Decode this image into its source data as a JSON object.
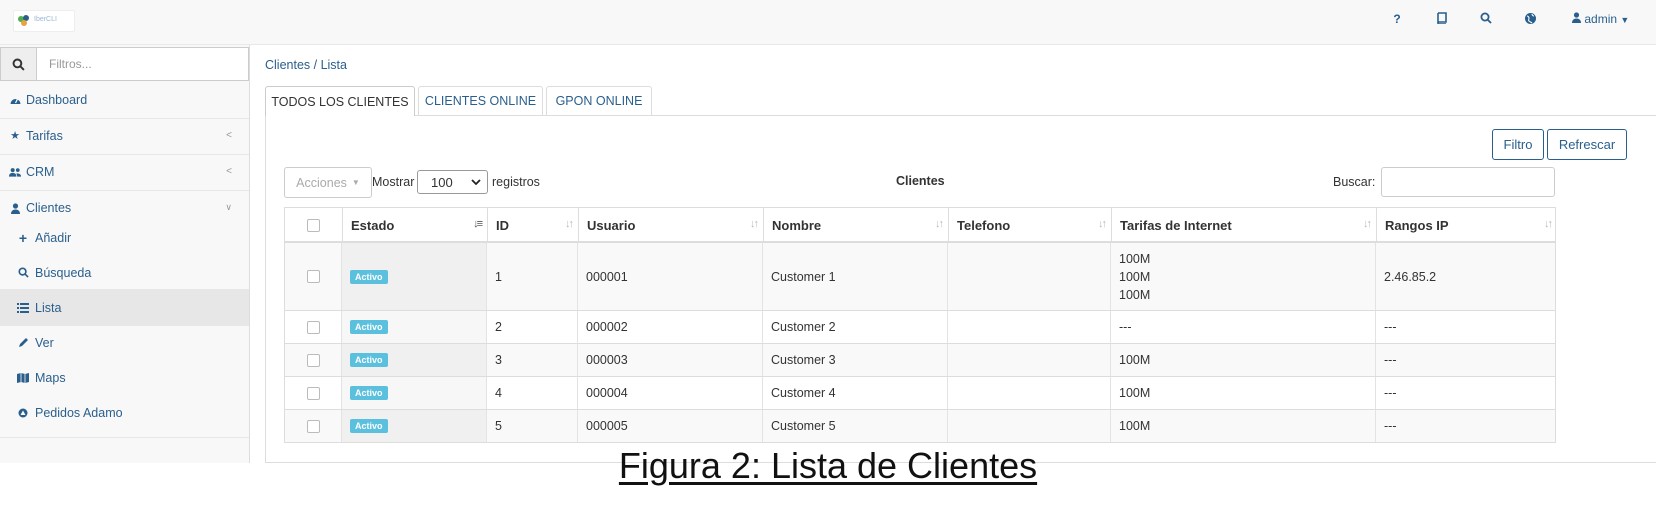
{
  "topbar": {
    "logo_text": "IberCLI",
    "help_label": "?",
    "user_label": "admin"
  },
  "sidebar": {
    "search_placeholder": "Filtros...",
    "items": [
      {
        "label": "Dashboard",
        "icon": "dashboard-icon"
      },
      {
        "label": "Tarifas",
        "icon": "star-icon"
      },
      {
        "label": "CRM",
        "icon": "users-icon"
      },
      {
        "label": "Clientes",
        "icon": "user-icon"
      }
    ],
    "subitems": [
      {
        "label": "Añadir",
        "icon": "plus-icon"
      },
      {
        "label": "Búsqueda",
        "icon": "search-icon"
      },
      {
        "label": "Lista",
        "icon": "list-icon"
      },
      {
        "label": "Ver",
        "icon": "pencil-icon"
      },
      {
        "label": "Maps",
        "icon": "map-icon"
      },
      {
        "label": "Pedidos Adamo",
        "icon": "circle-icon"
      }
    ]
  },
  "main": {
    "breadcrumb": "Clientes / Lista",
    "tabs": [
      "TODOS LOS CLIENTES",
      "CLIENTES ONLINE",
      "GPON ONLINE"
    ],
    "filter_button": "Filtro",
    "refresh_button": "Refrescar",
    "actions_label": "Acciones",
    "show_label": "Mostrar",
    "page_size": "100",
    "records_label": "registros",
    "table_title": "Clientes",
    "search_label": "Buscar:"
  },
  "table": {
    "columns": [
      "Estado",
      "ID",
      "Usuario",
      "Nombre",
      "Telefono",
      "Tarifas de Internet",
      "Rangos IP"
    ],
    "rows": [
      {
        "estado": "Activo",
        "id": "1",
        "usuario": "000001",
        "nombre": "Customer 1",
        "telefono": "",
        "tarifas": [
          "100M",
          "100M",
          "100M"
        ],
        "rangos": "2.46.85.2"
      },
      {
        "estado": "Activo",
        "id": "2",
        "usuario": "000002",
        "nombre": "Customer 2",
        "telefono": "",
        "tarifas": [
          "---"
        ],
        "rangos": "---"
      },
      {
        "estado": "Activo",
        "id": "3",
        "usuario": "000003",
        "nombre": "Customer 3",
        "telefono": "",
        "tarifas": [
          "100M"
        ],
        "rangos": "---"
      },
      {
        "estado": "Activo",
        "id": "4",
        "usuario": "000004",
        "nombre": "Customer 4",
        "telefono": "",
        "tarifas": [
          "100M"
        ],
        "rangos": "---"
      },
      {
        "estado": "Activo",
        "id": "5",
        "usuario": "000005",
        "nombre": "Customer 5",
        "telefono": "",
        "tarifas": [
          "100M"
        ],
        "rangos": "---"
      }
    ]
  },
  "caption": "Figura 2: Lista de Clientes",
  "colors": {
    "link": "#2a5f8d",
    "badge": "#5bc0de",
    "topbar": "#f8f8f8"
  }
}
